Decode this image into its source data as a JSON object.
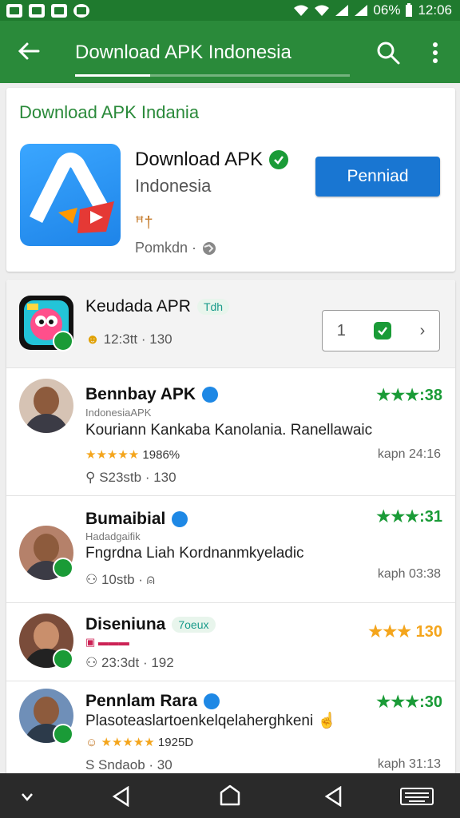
{
  "status": {
    "battery": "06%",
    "time": "12:06"
  },
  "appbar": {
    "title": "Download APK Indonesia"
  },
  "featured": {
    "section_title": "Download APK Indania",
    "name": "Download APK",
    "sub": "Indonesia",
    "meta_glyph": "ꟸ†",
    "dev": "Pomkdn ·",
    "install_label": "Penniad"
  },
  "list": [
    {
      "title": "Keudada APR",
      "tag": "Tdh",
      "meta": "12:3tt · 130",
      "stepper_left": "1",
      "stepper_right": "›"
    },
    {
      "title": "Bennbay APK",
      "small": "IndonesiaAPK",
      "desc": "Kouriann Kankaba Kanolania. Ranellawaic",
      "stars": "★★★★★",
      "stars_value": "1986%",
      "meta": "S23stb · 130",
      "rating": "★★★:38",
      "side": "kapn 24:16"
    },
    {
      "title": "Bumaibial",
      "small": "Hadadgaifik",
      "desc": "Fngrdna Liah Kordnanmkyeladic",
      "meta": "10stb · ",
      "rating": "★★★:31",
      "side": "kaph 03:38"
    },
    {
      "title": "Diseniuna",
      "tag": "7oeux",
      "meta": "23:3dt · 192",
      "rating": "★★★ 130",
      "side": ""
    },
    {
      "title": "Pennlam Rara",
      "desc": "Plasoteaslartoenkelqelaherghkeni",
      "stars": "★★★★★",
      "stars_value": "1925D",
      "meta": "S Sndaob · 30",
      "rating": "★★★:30",
      "side": "kaph 31:13"
    }
  ]
}
